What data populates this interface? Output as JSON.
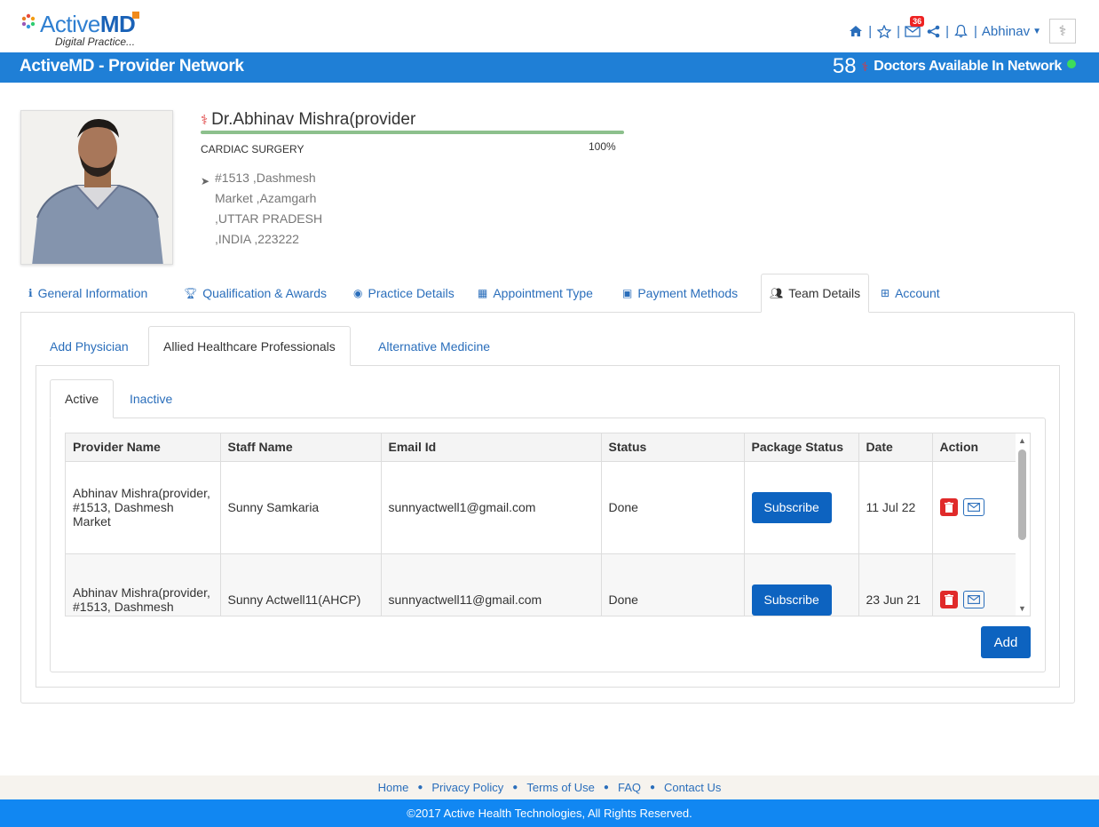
{
  "app": {
    "brand_active": "Active",
    "brand_md": "MD",
    "tagline": "Digital Practice...",
    "network_title": "ActiveMD - Provider Network",
    "doctors_count": "58",
    "doctors_label": "Doctors Available In Network",
    "online_color": "#3ddc5c"
  },
  "header": {
    "icons": [
      "home-icon",
      "star-icon",
      "mail-icon",
      "share-icon",
      "bell-icon"
    ],
    "mail_badge": "36",
    "user_name": "Abhinav"
  },
  "profile": {
    "name": "Dr.Abhinav Mishra(provider",
    "specialty": "CARDIAC SURGERY",
    "completion": "100%",
    "address": [
      "#1513 ,Dashmesh",
      "Market ,Azamgarh",
      ",UTTAR PRADESH",
      ",INDIA ,223222"
    ]
  },
  "main_tabs": [
    {
      "label": "General Information",
      "icon": "info-icon"
    },
    {
      "label": "Qualification & Awards",
      "icon": "trophy-icon"
    },
    {
      "label": "Practice Details",
      "icon": "target-icon"
    },
    {
      "label": "Appointment Type",
      "icon": "calendar-icon"
    },
    {
      "label": "Payment Methods",
      "icon": "money-icon"
    },
    {
      "label": "Team Details",
      "icon": "users-icon"
    },
    {
      "label": "Account",
      "icon": "medkit-icon"
    }
  ],
  "sub_tabs": [
    "Add Physician",
    "Allied Healthcare Professionals",
    "Alternative Medicine"
  ],
  "status_tabs": [
    "Active",
    "Inactive"
  ],
  "table": {
    "columns": [
      "Provider Name",
      "Staff Name",
      "Email Id",
      "Status",
      "Package Status",
      "Date",
      "Action"
    ],
    "rows": [
      {
        "provider": "Abhinav Mishra(provider, #1513, Dashmesh Market",
        "staff": "Sunny Samkaria",
        "email": "sunnyactwell1@gmail.com",
        "status": "Done",
        "package": "Subscribe",
        "date": "11 Jul 22"
      },
      {
        "provider": "Abhinav Mishra(provider, #1513, Dashmesh",
        "staff": "Sunny Actwell11(AHCP)",
        "email": "sunnyactwell11@gmail.com",
        "status": "Done",
        "package": "Subscribe",
        "date": "23 Jun 21"
      }
    ]
  },
  "add_button": "Add",
  "footer": {
    "links": [
      "Home",
      "Privacy Policy",
      "Terms of Use",
      "FAQ",
      "Contact Us"
    ],
    "copyright": "©2017 Active Health Technologies, All Rights Reserved."
  }
}
